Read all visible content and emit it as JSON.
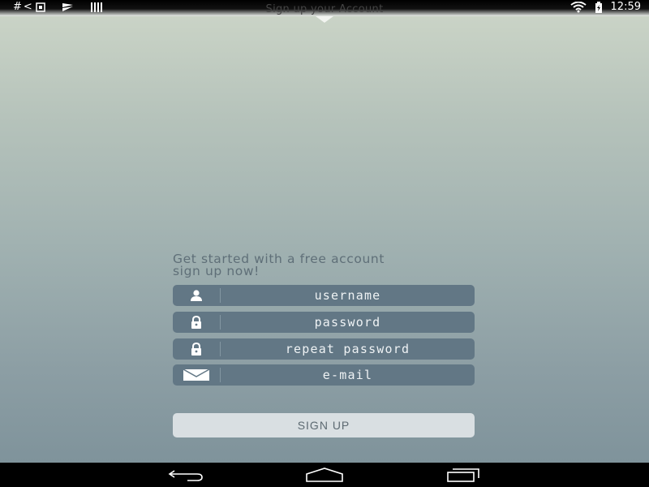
{
  "status_bar": {
    "time": "12:59",
    "left_icons": [
      "hash-icon",
      "back-arrow-icon",
      "image-icon",
      "flag-icon",
      "barcode-icon"
    ],
    "right_icons": [
      "wifi-icon",
      "battery-charging-icon"
    ]
  },
  "header": {
    "title": "Sign up your Account"
  },
  "form": {
    "tagline_line1": "Get started with a free account",
    "tagline_line2": "sign up now!",
    "fields": [
      {
        "icon": "user-icon",
        "placeholder": "username"
      },
      {
        "icon": "lock-icon",
        "placeholder": "password"
      },
      {
        "icon": "lock-icon",
        "placeholder": "repeat password"
      },
      {
        "icon": "envelope-icon",
        "placeholder": "e-mail"
      }
    ],
    "submit_label": "SIGN UP"
  },
  "nav_bar": {
    "buttons": [
      "back-icon",
      "home-icon",
      "recents-icon"
    ]
  },
  "colors": {
    "field_bg": "#627785",
    "button_bg": "#d9dfe2",
    "gradient_top": "#cdd6c8",
    "gradient_bottom": "#7f939b"
  }
}
